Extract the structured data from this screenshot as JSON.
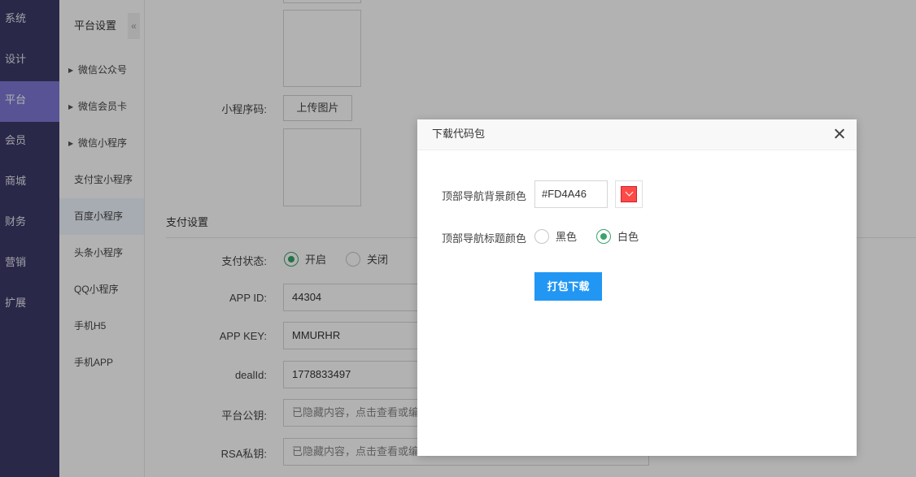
{
  "nav": {
    "items": [
      {
        "label": "系统"
      },
      {
        "label": "设计"
      },
      {
        "label": "平台"
      },
      {
        "label": "会员"
      },
      {
        "label": "商城"
      },
      {
        "label": "财务"
      },
      {
        "label": "营销"
      },
      {
        "label": "扩展"
      }
    ],
    "active_index": 2
  },
  "sidebar": {
    "title": "平台设置",
    "collapse_glyph": "«",
    "items": [
      {
        "label": "微信公众号",
        "expandable": true
      },
      {
        "label": "微信会员卡",
        "expandable": true
      },
      {
        "label": "微信小程序",
        "expandable": true
      },
      {
        "label": "支付宝小程序",
        "expandable": false
      },
      {
        "label": "百度小程序",
        "expandable": false,
        "active": true
      },
      {
        "label": "头条小程序",
        "expandable": false
      },
      {
        "label": "QQ小程序",
        "expandable": false
      },
      {
        "label": "手机H5",
        "expandable": false
      },
      {
        "label": "手机APP",
        "expandable": false
      }
    ]
  },
  "form": {
    "qrcode_label": "小程序码:",
    "upload_button": "上传图片",
    "pay_section_title": "支付设置",
    "pay_status_label": "支付状态:",
    "pay_status_options": [
      "开启",
      "关闭"
    ],
    "pay_status_selected": "开启",
    "app_id_label": "APP ID:",
    "app_id_value": "44304",
    "app_key_label": "APP KEY:",
    "app_key_value": "MMURHR",
    "deal_id_label": "dealId:",
    "deal_id_value": "1778833497",
    "public_key_label": "平台公钥:",
    "public_key_value": "已隐藏内容，点击查看或编辑",
    "rsa_key_label": "RSA私钥:",
    "rsa_key_value": "已隐藏内容，点击查看或编辑"
  },
  "modal": {
    "title": "下载代码包",
    "bg_color_label": "顶部导航背景颜色",
    "bg_color_value": "#FD4A46",
    "title_color_label": "顶部导航标题颜色",
    "title_color_options": [
      "黑色",
      "白色"
    ],
    "title_color_selected": "白色",
    "pack_button": "打包下载"
  },
  "colors": {
    "nav_bg": "#3d3a67",
    "nav_active": "#7d78d6",
    "accent_blue": "#2196f3",
    "radio_green": "#3aa36b",
    "swatch": "#FD4A46"
  }
}
